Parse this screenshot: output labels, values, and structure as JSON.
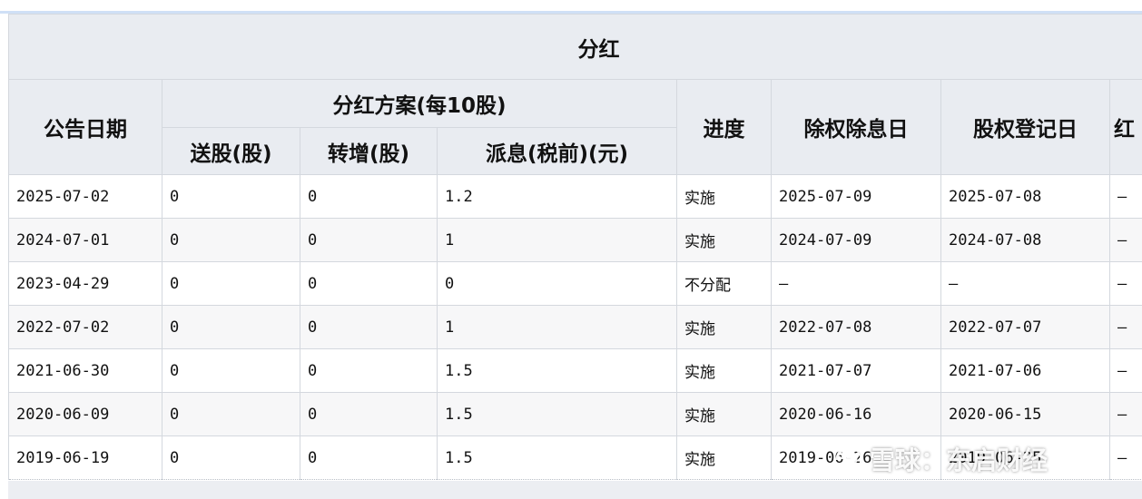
{
  "table": {
    "group_title": "分红",
    "headers": {
      "announce_date": "公告日期",
      "plan_group": "分红方案(每10股)",
      "bonus_shares": "送股(股)",
      "transfer_shares": "转增(股)",
      "cash_dividend": "派息(税前)(元)",
      "progress": "进度",
      "ex_date": "除权除息日",
      "record_date": "股权登记日",
      "next_col_partial": "红"
    },
    "rows": [
      {
        "announce_date": "2025-07-02",
        "bonus": "0",
        "transfer": "0",
        "cash": "1.2",
        "progress": "实施",
        "ex_date": "2025-07-09",
        "record_date": "2025-07-08",
        "next": "—"
      },
      {
        "announce_date": "2024-07-01",
        "bonus": "0",
        "transfer": "0",
        "cash": "1",
        "progress": "实施",
        "ex_date": "2024-07-09",
        "record_date": "2024-07-08",
        "next": "—"
      },
      {
        "announce_date": "2023-04-29",
        "bonus": "0",
        "transfer": "0",
        "cash": "0",
        "progress": "不分配",
        "ex_date": "—",
        "record_date": "—",
        "next": "—"
      },
      {
        "announce_date": "2022-07-02",
        "bonus": "0",
        "transfer": "0",
        "cash": "1",
        "progress": "实施",
        "ex_date": "2022-07-08",
        "record_date": "2022-07-07",
        "next": "—"
      },
      {
        "announce_date": "2021-06-30",
        "bonus": "0",
        "transfer": "0",
        "cash": "1.5",
        "progress": "实施",
        "ex_date": "2021-07-07",
        "record_date": "2021-07-06",
        "next": "—"
      },
      {
        "announce_date": "2020-06-09",
        "bonus": "0",
        "transfer": "0",
        "cash": "1.5",
        "progress": "实施",
        "ex_date": "2020-06-16",
        "record_date": "2020-06-15",
        "next": "—"
      },
      {
        "announce_date": "2019-06-19",
        "bonus": "0",
        "transfer": "0",
        "cash": "1.5",
        "progress": "实施",
        "ex_date": "2019-06-26",
        "record_date": "2019-06-25",
        "next": "—"
      }
    ]
  },
  "watermark": {
    "text": "雪球：东启财经",
    "icon": "snowball-logo-icon"
  }
}
